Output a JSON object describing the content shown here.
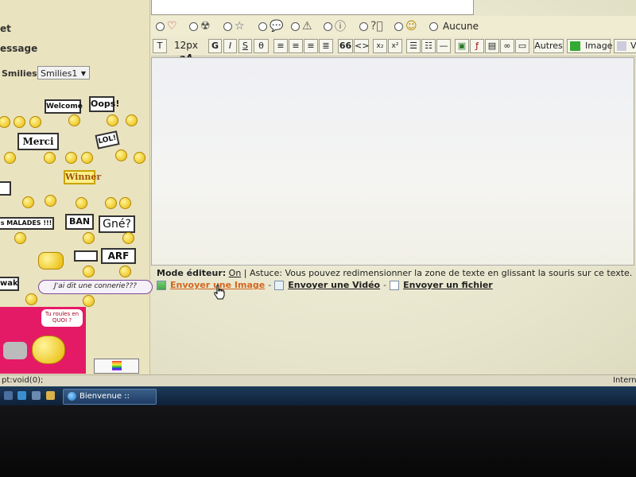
{
  "labels": {
    "sujet": "et",
    "message": "essage",
    "smilies": "Smilies:"
  },
  "smilies_select": "Smilies1",
  "signs": {
    "welcome": "Welcome",
    "oops": "Oops!",
    "merci": "Merci",
    "lol": "LOL!",
    "winner": "Winner",
    "malades": "s MALADES !!!",
    "ban": "BAN",
    "gne": "Gné?",
    "arf": "ARF",
    "wak": "wak",
    "connerie": "J'ai dit une connerie???",
    "bubble": "Tu roules en QUOI ?"
  },
  "radios": {
    "aucune": "Aucune"
  },
  "toolbar": {
    "size": "12px",
    "bold": "G",
    "italic": "I",
    "strike": "S",
    "quote": "66",
    "code": "<>",
    "autres": "Autres",
    "image": "Image",
    "video": "Vi"
  },
  "editor": {
    "mode_label": "Mode éditeur:",
    "mode_value": "On",
    "astuce": "| Astuce: Vous pouvez redimensionner la zone de texte en glissant la souris sur ce texte."
  },
  "links": {
    "image": "Envoyer une Image",
    "video": "Envoyer une Vidéo",
    "fichier": "Envoyer un fichier",
    "sep": "-"
  },
  "status": {
    "left": "pt:void(0);",
    "right": "Interne"
  },
  "taskbar": {
    "task": "Bienvenue :: Poster ..."
  }
}
